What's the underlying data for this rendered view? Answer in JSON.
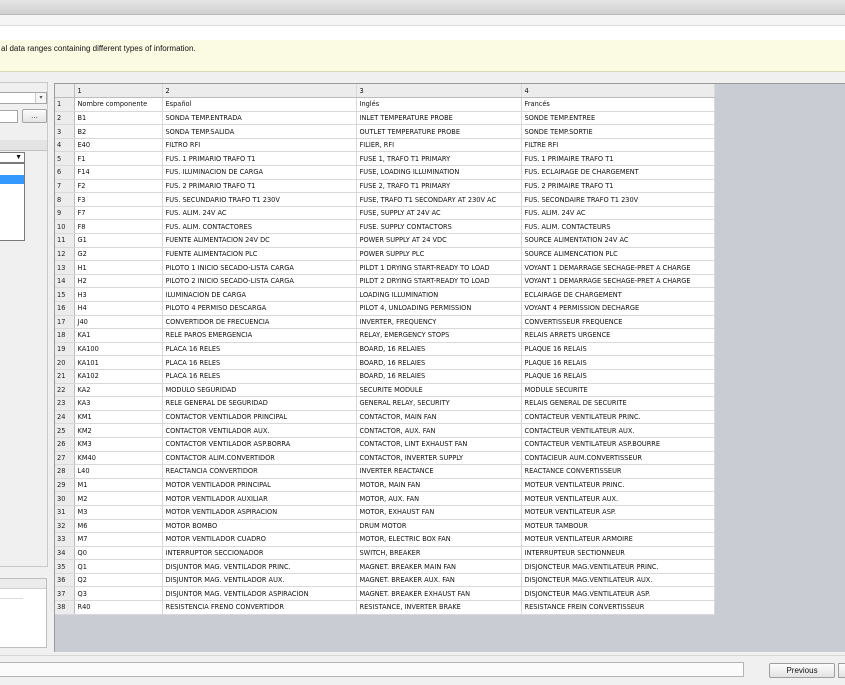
{
  "info": {
    "text": "al data ranges containing different types of information."
  },
  "left": {
    "dots_label": "..."
  },
  "grid": {
    "col_numbers": [
      "1",
      "2",
      "3",
      "4"
    ],
    "rows": [
      [
        "1",
        "Nombre componente",
        "Español",
        "Inglés",
        "Francés"
      ],
      [
        "2",
        "B1",
        "SONDA TEMP.ENTRADA",
        "INLET TEMPERATURE PROBE",
        "SONDE TEMP.ENTREE"
      ],
      [
        "3",
        "B2",
        "SONDA TEMP.SALIDA",
        "OUTLET TEMPERATURE PROBE",
        "SONDE TEMP.SORTIE"
      ],
      [
        "4",
        "E40",
        "FILTRO RFI",
        "FILIER, RFI",
        "FILTRE RFI"
      ],
      [
        "5",
        "F1",
        "FUS. 1 PRIMARIO TRAFO T1",
        "FUSE 1, TRAFO T1 PRIMARY",
        "FUS. 1 PRIMAIRE TRAFO T1"
      ],
      [
        "6",
        "F14",
        "FUS. ILUMINACION DE CARGA",
        "FUSE, LOADING ILLUMINATION",
        "FUS. ECLAIRAGE DE CHARGEMENT"
      ],
      [
        "7",
        "F2",
        "FUS. 2 PRIMARIO TRAFO T1",
        "FUSE 2, TRAFO T1 PRIMARY",
        "FUS. 2 PRIMAIRE TRAFO T1"
      ],
      [
        "8",
        "F3",
        "FUS. SECUNDARIO TRAFO T1 230V",
        "FUSE, TRAFO T1 SECONDARY AT 230V AC",
        "FUS. SECONDAIRE TRAFO T1 230V"
      ],
      [
        "9",
        "F7",
        "FUS. ALIM. 24V AC",
        "FUSE, SUPPLY AT 24V AC",
        "FUS. ALIM. 24V AC"
      ],
      [
        "10",
        "F8",
        "FUS. ALIM. CONTACTORES",
        "FUSE. SUPPLY CONTACTORS",
        "FUS. ALIM. CONTACTEURS"
      ],
      [
        "11",
        "G1",
        "FUENTE ALIMENTACION 24V DC",
        "POWER SUPPLY AT 24 VDC",
        "SOURCE ALIMENTATION 24V AC"
      ],
      [
        "12",
        "G2",
        "FUENTE ALIMENTACION PLC",
        "POWER SUPPLY PLC",
        "SOURCE ALIMENCATION PLC"
      ],
      [
        "13",
        "H1",
        "PILOTO 1 INICIO SECADO-LISTA CARGA",
        "PILDT 1 DRYING START-READY TO LOAD",
        "VOYANT 1 DEMARRAGE SECHAGE-PRET A CHARGE"
      ],
      [
        "14",
        "H2",
        "PILOTO 2 INICIO SECADO-LISTA CARGA",
        "PILDT 2 DRYING START-READY TO LOAD",
        "VOYANT 1 DEMARRAGE SECHAGE-PRET A CHARGE"
      ],
      [
        "15",
        "H3",
        "ILUMINACION DE CARGA",
        "LOADING ILLUMINATION",
        "ECLAIRAGE DE CHARGEMENT"
      ],
      [
        "16",
        "H4",
        "PILOTO 4 PERMISO DESCARGA",
        "PILOT 4, UNLOADING PERMISSION",
        "VOYANT 4 PERMISSION DECHARGE"
      ],
      [
        "17",
        "J40",
        "CONVERTIDOR DE FRECUENCIA",
        "INVERTER, FREQUENCY",
        "CONVERTISSEUR FREQUENCE"
      ],
      [
        "18",
        "KA1",
        "RELE PAROS EMERGENCIA",
        "RELAY, EMERGENCY STOPS",
        "RELAIS ARRETS URGENCE"
      ],
      [
        "19",
        "KA100",
        "PLACA 16 RELES",
        "BOARD, 16 RELAIES",
        "PLAQUE 16 RELAIS"
      ],
      [
        "20",
        "KA101",
        "PLACA 16 RELES",
        "BOARD, 16 RELAIES",
        "PLAQUE 16 RELAIS"
      ],
      [
        "21",
        "KA102",
        "PLACA 16 RELES",
        "BOARD, 16 RELAIES",
        "PLAQUE 16 RELAIS"
      ],
      [
        "22",
        "KA2",
        "MODULO SEGURIDAD",
        "SECURITE MODULE",
        "MODULE SECURITE"
      ],
      [
        "23",
        "KA3",
        "RELE GENERAL DE SEGURIDAD",
        "GENERAL RELAY, SECURITY",
        "RELAIS GENERAL DE SECURITE"
      ],
      [
        "24",
        "KM1",
        "CONTACTOR VENTILADOR PRINCIPAL",
        "CONTACTOR, MAIN FAN",
        "CONTACTEUR VENTILATEUR PRINC."
      ],
      [
        "25",
        "KM2",
        "CONTACTOR VENTILADOR AUX.",
        "CONTACTOR, AUX. FAN",
        "CONTACTEUR VENTILATEUR AUX."
      ],
      [
        "26",
        "KM3",
        "CONTACTOR VENTILADOR ASP.BORRA",
        "CONTACTOR, LINT EXHAUST FAN",
        "CONTACTEUR VENTILATEUR ASP.BOURRE"
      ],
      [
        "27",
        "KM40",
        "CONTACTOR ALIM.CONVERTIDOR",
        "CONTACTOR, INVERTER SUPPLY",
        "CONTACIEUR AUM.CONVERTISSEUR"
      ],
      [
        "28",
        "L40",
        "REACTANCIA CONVERTIDOR",
        "INVERTER REACTANCE",
        "REACTANCE CONVERTISSEUR"
      ],
      [
        "29",
        "M1",
        "MOTOR VENTILADOR PRINCIPAL",
        "MOTOR, MAIN FAN",
        "MOTEUR VENTILATEUR PRINC."
      ],
      [
        "30",
        "M2",
        "MOTOR VENTILADOR AUXILIAR",
        "MOTOR, AUX. FAN",
        "MOTEUR VENTILATEUR AUX."
      ],
      [
        "31",
        "M3",
        "MOTOR VENTILADOR ASPIRACION",
        "MOTOR, EXHAUST FAN",
        "MOTEUR VENTILATEUR ASP."
      ],
      [
        "32",
        "M6",
        "MOTOR BOMBO",
        "DRUM MOTOR",
        "MOTEUR TAMBOUR"
      ],
      [
        "33",
        "M7",
        "MOTOR VENTILADOR CUADRO",
        "MOTOR, ELECTRIC BOX FAN",
        "MOTEUR VENTILATEUR ARMOIRE"
      ],
      [
        "34",
        "Q0",
        "INTERRUPTOR SECCIONADOR",
        "SWITCH, BREAKER",
        "INTERRUPTEUR SECTIONNEUR"
      ],
      [
        "35",
        "Q1",
        "DISJUNTOR MAG. VENTILADOR PRINC.",
        "MAGNET. BREAKER MAIN FAN",
        "DISJONCTEUR MAG.VENTILATEUR PRINC."
      ],
      [
        "36",
        "Q2",
        "DISJUNTOR MAG. VENTILADOR AUX.",
        "MAGNET. BREAKER AUX. FAN",
        "DISJONCTEUR MAG.VENTILATEUR AUX."
      ],
      [
        "37",
        "Q3",
        "DISJUNTOR MAG. VENTILADOR ASPIRACION",
        "MAGNET. BREAKER EXHAUST FAN",
        "DISJONCTEUR MAG.VENTILATEUR ASP."
      ],
      [
        "38",
        "R40",
        "RESISTENCIA FRENO CONVERTIDOR",
        "RESISTANCE, INVERTER BRAKE",
        "RESISTANCE FREIN CONVERTISSEUR"
      ]
    ]
  },
  "footer": {
    "previous_label": "Previous"
  }
}
